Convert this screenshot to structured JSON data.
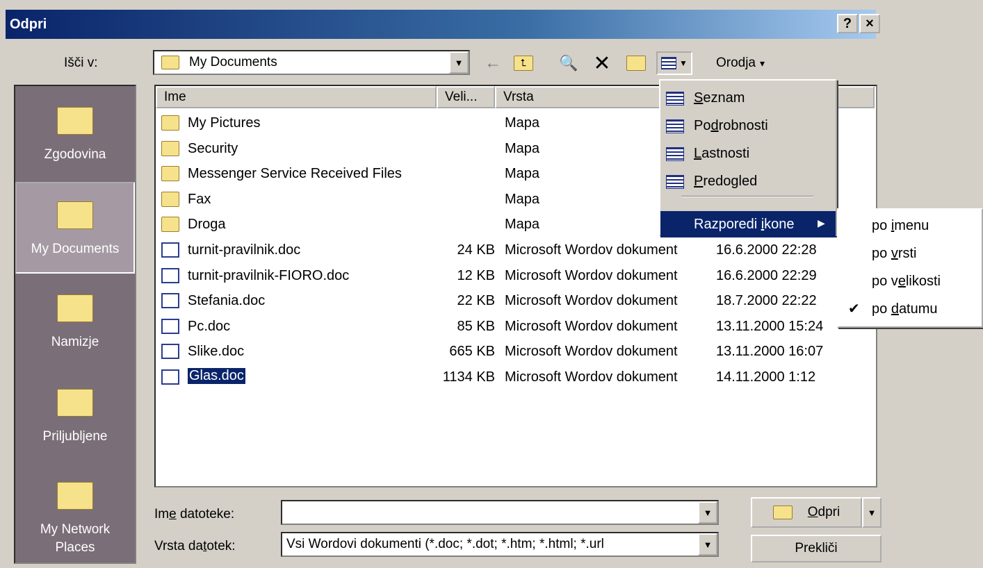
{
  "window": {
    "title": "Odpri",
    "help": "?",
    "close": "×"
  },
  "lookin": {
    "label": "Išči v:",
    "value": "My Documents"
  },
  "toolbar": {
    "tools_label": "Orodja",
    "tools_arrow": "▾"
  },
  "places": [
    {
      "label": "Zgodovina",
      "icon": "history-icon"
    },
    {
      "label": "My Documents",
      "icon": "my-documents-icon"
    },
    {
      "label": "Namizje",
      "icon": "desktop-icon"
    },
    {
      "label": "Priljubljene",
      "icon": "favorites-icon"
    },
    {
      "label": "My Network Places",
      "icon": "network-places-icon"
    }
  ],
  "columns": {
    "name": "Ime",
    "size": "Veli...",
    "type": "Vrsta"
  },
  "files": [
    {
      "name": "My Pictures",
      "size": "",
      "type": "Mapa",
      "date": "",
      "kind": "pictures"
    },
    {
      "name": "Security",
      "size": "",
      "type": "Mapa",
      "date": "",
      "kind": "folder"
    },
    {
      "name": "Messenger Service Received Files",
      "size": "",
      "type": "Mapa",
      "date": "",
      "kind": "folder"
    },
    {
      "name": "Fax",
      "size": "",
      "type": "Mapa",
      "date": "",
      "kind": "folder"
    },
    {
      "name": "Droga",
      "size": "",
      "type": "Mapa",
      "date": "",
      "kind": "folder"
    },
    {
      "name": "turnit-pravilnik.doc",
      "size": "24 KB",
      "type": "Microsoft Wordov dokument",
      "date": "16.6.2000 22:28",
      "kind": "doc"
    },
    {
      "name": "turnit-pravilnik-FIORO.doc",
      "size": "12 KB",
      "type": "Microsoft Wordov dokument",
      "date": "16.6.2000 22:29",
      "kind": "doc"
    },
    {
      "name": "Stefania.doc",
      "size": "22 KB",
      "type": "Microsoft Wordov dokument",
      "date": "18.7.2000 22:22",
      "kind": "doc"
    },
    {
      "name": "Pc.doc",
      "size": "85 KB",
      "type": "Microsoft Wordov dokument",
      "date": "13.11.2000 15:24",
      "kind": "doc"
    },
    {
      "name": "Slike.doc",
      "size": "665 KB",
      "type": "Microsoft Wordov dokument",
      "date": "13.11.2000 16:07",
      "kind": "doc"
    },
    {
      "name": "Glas.doc",
      "size": "1134 KB",
      "type": "Microsoft Wordov dokument",
      "date": "14.11.2000 1:12",
      "kind": "doc",
      "selected": true
    }
  ],
  "view_menu": {
    "items": [
      {
        "pre": "",
        "u": "S",
        "post": "eznam"
      },
      {
        "pre": "Po",
        "u": "d",
        "post": "robnosti"
      },
      {
        "pre": "",
        "u": "L",
        "post": "astnosti"
      },
      {
        "pre": "",
        "u": "P",
        "post": "redogled"
      }
    ],
    "arrange": {
      "pre": "Razporedi ",
      "u": "i",
      "post": "kone",
      "arrow": "▶"
    }
  },
  "arrange_submenu": [
    {
      "pre": "po ",
      "u": "i",
      "post": "menu",
      "checked": false
    },
    {
      "pre": "po ",
      "u": "v",
      "post": "rsti",
      "checked": false
    },
    {
      "pre": "po v",
      "u": "e",
      "post": "likosti",
      "checked": false
    },
    {
      "pre": "po ",
      "u": "d",
      "post": "atumu",
      "checked": true
    }
  ],
  "check_mark": "✔",
  "filename": {
    "label_pre": "Im",
    "label_u": "e",
    "label_post": " datoteke:",
    "value": ""
  },
  "filetype": {
    "label_pre": "Vrsta da",
    "label_u": "t",
    "label_post": "otek:",
    "value": "Vsi Wordovi dokumenti (*.doc; *.dot; *.htm; *.html; *.url"
  },
  "open_button": {
    "u": "O",
    "post": "dpri"
  },
  "cancel_button": {
    "label": "Prekliči"
  },
  "colors": {
    "selection": "#0a246a",
    "title_start": "#0a246a",
    "places_bg": "#7a6e78"
  }
}
